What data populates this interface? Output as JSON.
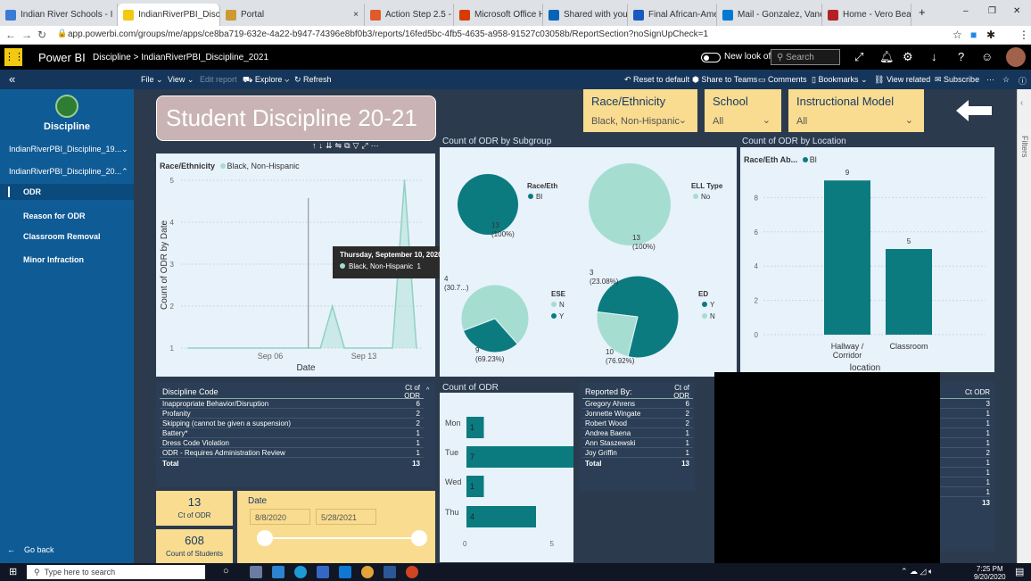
{
  "browser": {
    "tabs": [
      {
        "title": "Indian River Schools - I",
        "color": "#3a7bd5",
        "active": false
      },
      {
        "title": "IndianRiverPBI_Disciplin",
        "color": "#f2c811",
        "active": true
      },
      {
        "title": "Portal",
        "color": "#cc9933",
        "active": false
      },
      {
        "title": "Action Step 2.5 - Out-",
        "color": "#e05a2b",
        "active": false
      },
      {
        "title": "Microsoft Office Home",
        "color": "#d83b01",
        "active": false
      },
      {
        "title": "Shared with you - One",
        "color": "#0364b8",
        "active": false
      },
      {
        "title": "Final African-American",
        "color": "#185abd",
        "active": false
      },
      {
        "title": "Mail - Gonzalez, Vanes",
        "color": "#0078d4",
        "active": false
      },
      {
        "title": "Home - Vero Beach Hi",
        "color": "#b22222",
        "active": false
      }
    ],
    "url": "app.powerbi.com/groups/me/apps/ce8ba719-632e-4a22-b947-74396e8bf0b3/reports/16fed5bc-4fb5-4635-a958-91527c03058b/ReportSection?noSignUpCheck=1"
  },
  "header": {
    "brand": "Power BI",
    "breadcrumb": "Discipline  >  IndianRiverPBI_Discipline_2021",
    "new_look": "New look off",
    "search_placeholder": "Search"
  },
  "ribbon": {
    "file": "File",
    "view": "View",
    "edit_report": "Edit report",
    "explore": "Explore",
    "refresh": "Refresh",
    "reset": "Reset to default",
    "share_teams": "Share to Teams",
    "comments": "Comments",
    "bookmarks": "Bookmarks",
    "view_related": "View related",
    "subscribe": "Subscribe"
  },
  "nav": {
    "title": "Discipline",
    "items": [
      {
        "label": "IndianRiverPBI_Discipline_19...",
        "sub": false,
        "selected": false
      },
      {
        "label": "IndianRiverPBI_Discipline_20...",
        "sub": false,
        "selected": false
      },
      {
        "label": "ODR",
        "sub": true,
        "selected": true
      },
      {
        "label": "Reason for ODR",
        "sub": true,
        "selected": false
      },
      {
        "label": "Classroom Removal",
        "sub": true,
        "selected": false
      },
      {
        "label": "Minor Infraction",
        "sub": true,
        "selected": false
      }
    ],
    "go_back": "Go back"
  },
  "report": {
    "title": "Student Discipline 20-21",
    "slicers": [
      {
        "label": "Race/Ethnicity",
        "value": "Black, Non-Hispanic"
      },
      {
        "label": "School",
        "value": "All"
      },
      {
        "label": "Instructional Model",
        "value": "All"
      }
    ],
    "filters_label": "Filters"
  },
  "line_chart_header": {
    "legend_title": "Race/Ethnicity",
    "legend_item": "Black, Non-Hispanic",
    "legend_color": "#a6ddd1"
  },
  "tooltip": {
    "date": "Thursday, September 10, 2020",
    "series": "Black, Non-Hispanic",
    "value": "1"
  },
  "pies_title": "Count of ODR by Subgroup",
  "bar_title": "Count of ODR by Location",
  "bar_legend": {
    "title": "Race/Eth Ab...",
    "item": "Bl"
  },
  "chart_data": [
    {
      "type": "area",
      "ylabel": "Count of ODR by Date",
      "xlabel": "Date",
      "x_ticks": [
        "Sep 06",
        "Sep 13"
      ],
      "ylim": [
        1,
        5
      ],
      "y_ticks": [
        1,
        2,
        3,
        4,
        5
      ],
      "series": [
        {
          "name": "Black, Non-Hispanic",
          "color": "#a6ddd1",
          "values": [
            1,
            1,
            1,
            1,
            1,
            1,
            1,
            1,
            1,
            1,
            1,
            1,
            2,
            1,
            1,
            1,
            1,
            1,
            5,
            1
          ]
        }
      ]
    },
    {
      "type": "pie",
      "title": "Race/Eth",
      "labels": [
        "Bl"
      ],
      "values": [
        13
      ],
      "value_labels": [
        "13\n(100%)"
      ],
      "colors": [
        "#0b7b80"
      ]
    },
    {
      "type": "pie",
      "title": "ELL Type",
      "labels": [
        "No"
      ],
      "values": [
        13
      ],
      "value_labels": [
        "13\n(100%)"
      ],
      "colors": [
        "#a6ddd1"
      ]
    },
    {
      "type": "pie",
      "title": "ESE",
      "labels": [
        "N",
        "Y"
      ],
      "values": [
        9,
        4
      ],
      "value_labels": [
        "9\n(69.23%)",
        "4\n(30.7...)"
      ],
      "colors": [
        "#a6ddd1",
        "#0b7b80"
      ]
    },
    {
      "type": "pie",
      "title": "ED",
      "labels": [
        "Y",
        "N"
      ],
      "values": [
        10,
        3
      ],
      "value_labels": [
        "10\n(76.92%)",
        "3\n(23.08%)"
      ],
      "colors": [
        "#0b7b80",
        "#a6ddd1"
      ]
    },
    {
      "type": "bar",
      "xlabel": "location",
      "categories": [
        "Hallway / Corridor",
        "Classroom"
      ],
      "values": [
        9,
        5
      ],
      "ylim": [
        0,
        9
      ],
      "y_ticks": [
        0,
        2,
        4,
        6,
        8
      ],
      "color": "#0b7b80"
    },
    {
      "type": "bar",
      "orientation": "horizontal",
      "title": "Count of ODR",
      "categories": [
        "Mon",
        "Tue",
        "Wed",
        "Thu"
      ],
      "values": [
        1,
        7,
        1,
        4
      ],
      "x_ticks": [
        0,
        5
      ],
      "color": "#0b7b80"
    }
  ],
  "discipline_table": {
    "col1": "Discipline Code",
    "col2": "Ct of ODR",
    "rows": [
      [
        "Inappropriate Behavior/Disruption",
        "6"
      ],
      [
        "Profanity",
        "2"
      ],
      [
        "Skipping (cannot be given a suspension)",
        "2"
      ],
      [
        "Battery*",
        "1"
      ],
      [
        "Dress Code Violation",
        "1"
      ],
      [
        "ODR - Requires Administration Review",
        "1"
      ]
    ],
    "total_label": "Total",
    "total": "13"
  },
  "reporter_table": {
    "col1": "Reported By:",
    "col2": "Ct of ODR",
    "rows": [
      [
        "Gregory Ahrens",
        "6"
      ],
      [
        "Jonnette Wingate",
        "2"
      ],
      [
        "Robert Wood",
        "2"
      ],
      [
        "Andrea Baena",
        "1"
      ],
      [
        "Ann Staszewski",
        "1"
      ],
      [
        "Joy Griffin",
        "1"
      ]
    ],
    "total_label": "Total",
    "total": "13"
  },
  "right_table": {
    "col2": "Ct ODR",
    "values": [
      "3",
      "1",
      "1",
      "1",
      "1",
      "2",
      "1",
      "1",
      "1",
      "1"
    ],
    "total": "13"
  },
  "cards": {
    "odr_value": "13",
    "odr_label": "Ct of ODR",
    "students_value": "608",
    "students_label": "Count of Students",
    "date_label": "Date",
    "date_start": "8/8/2020",
    "date_end": "5/28/2021"
  },
  "taskbar": {
    "search": "Type here to search",
    "time": "7:25 PM",
    "date": "9/20/2020"
  }
}
